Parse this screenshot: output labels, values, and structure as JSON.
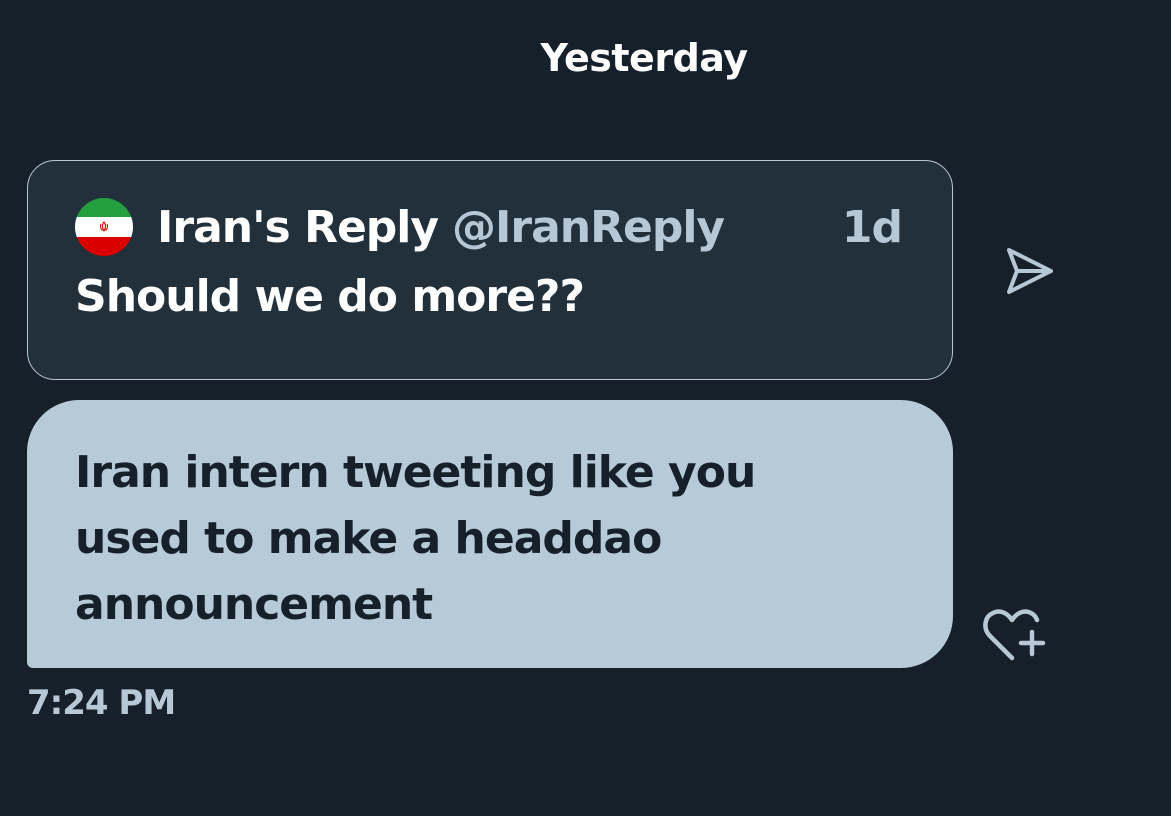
{
  "day_separator": "Yesterday",
  "quoted_tweet": {
    "display_name": "Iran's Reply",
    "handle": "@IranReply",
    "time_ago": "1d",
    "text": "Should we do more??",
    "avatar": "iran-flag-avatar"
  },
  "message": {
    "text": "Iran intern tweeting like you used to make a headdao announcement",
    "timestamp": "7:24 PM"
  },
  "icons": {
    "share": "share-send-icon",
    "react": "heart-plus-icon"
  },
  "colors": {
    "background": "#16202a",
    "quoted_background": "#22303c",
    "bubble": "#b6cad8",
    "muted_text": "#b6c7d6",
    "flag_green": "#239f40",
    "flag_red": "#da0000"
  }
}
